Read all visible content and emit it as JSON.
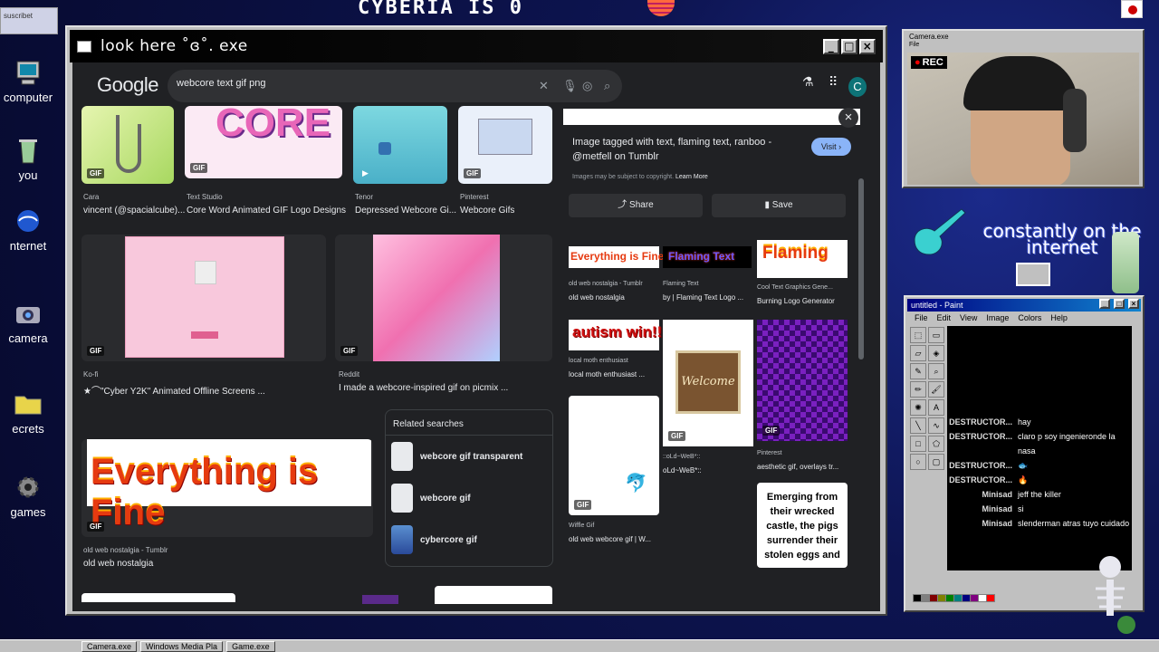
{
  "desktop": {
    "banner": "CYBERIA IS 0",
    "sticky_note": "suscribet",
    "icons": [
      {
        "label": "computer",
        "icon": "computer-icon"
      },
      {
        "label": "you",
        "icon": "recycle-bin-icon"
      },
      {
        "label": "nternet",
        "icon": "internet-icon"
      },
      {
        "label": "camera",
        "icon": "camera-icon"
      },
      {
        "label": "ecrets",
        "icon": "folder-icon"
      },
      {
        "label": "games",
        "icon": "gear-icon"
      }
    ],
    "deco_text": "constantly on the internet"
  },
  "browser": {
    "window_title": "look here ˚ɞ˚. exe",
    "google_logo": "Google",
    "search_query": "webcore text gif png",
    "account_initial": "C",
    "results": [
      {
        "source": "Cara",
        "title": "vincent (@spacialcube)..."
      },
      {
        "source": "Text Studio",
        "title": "Core Word Animated GIF Logo Designs",
        "image_text": "CORE"
      },
      {
        "source": "Tenor",
        "title": "Depressed Webcore Gi..."
      },
      {
        "source": "Pinterest",
        "title": "Webcore Gifs"
      },
      {
        "source": "Ko-fi",
        "title": "★⌒\"Cyber Y2K\" Animated Offline Screens ..."
      },
      {
        "source": "Reddit",
        "title": "I made a webcore-inspired gif on picmix ..."
      },
      {
        "source": "old web nostalgia - Tumblr",
        "title": "old web nostalgia",
        "image_text": "Everything is Fine"
      }
    ],
    "related": {
      "heading": "Related searches",
      "items": [
        "webcore gif transparent",
        "webcore gif",
        "cybercore gif"
      ]
    },
    "gif_badge": "GIF",
    "preview": {
      "title": "Image tagged with text, flaming text, ranboo - @metfell on Tumblr",
      "visit": "Visit",
      "copyright": "Images may be subject to copyright.",
      "learn_more": "Learn More",
      "share": "Share",
      "save": "Save",
      "related": [
        {
          "source": "old web nostalgia - Tumblr",
          "title": "old web nostalgia",
          "image_text": "Everything is Fine"
        },
        {
          "source": "Flaming Text",
          "title": "by | Flaming Text Logo ...",
          "image_text": "Flaming Text"
        },
        {
          "source": "Cool Text Graphics Gene...",
          "title": "Burning Logo Generator",
          "image_text": "Flaming"
        },
        {
          "source": "local moth enthusiast",
          "title": "local moth enthusiast ...",
          "image_text": "autism win!!"
        },
        {
          "source": "::oLd~WeB*::",
          "title": "oLd~WeB*::",
          "image_text": "Welcome"
        },
        {
          "source": "Pinterest",
          "title": "aesthetic gif, overlays tr..."
        },
        {
          "source": "Wiffle Gif",
          "title": "old web webcore gif | W..."
        },
        {
          "source": "",
          "title": "",
          "image_text": "Emerging from their wrecked castle, the pigs surrender their stolen eggs and"
        }
      ]
    }
  },
  "camera": {
    "title": "Camera.exe",
    "menu": "File",
    "rec": "REC"
  },
  "paint": {
    "title": "untitled - Paint",
    "menu": [
      "File",
      "Edit",
      "View",
      "Image",
      "Colors",
      "Help"
    ],
    "chat": [
      {
        "user": "DESTRUCTOR...",
        "text": "hay"
      },
      {
        "user": "DESTRUCTOR...",
        "text": "claro p soy ingenieronde la nasa"
      },
      {
        "user": "DESTRUCTOR...",
        "text": "🐟"
      },
      {
        "user": "DESTRUCTOR...",
        "text": "🔥"
      },
      {
        "user": "Minisad",
        "text": "jeff the killer"
      },
      {
        "user": "Minisad",
        "text": "si"
      },
      {
        "user": "Minisad",
        "text": "slenderman atras tuyo cuidado"
      }
    ],
    "palette": [
      "#000000",
      "#808080",
      "#800000",
      "#808000",
      "#008000",
      "#008080",
      "#000080",
      "#800080",
      "#ffffff",
      "#ff0000"
    ]
  },
  "taskbar": {
    "items": [
      "Camera.exe",
      "Windows Media Pla",
      "Game.exe"
    ]
  }
}
